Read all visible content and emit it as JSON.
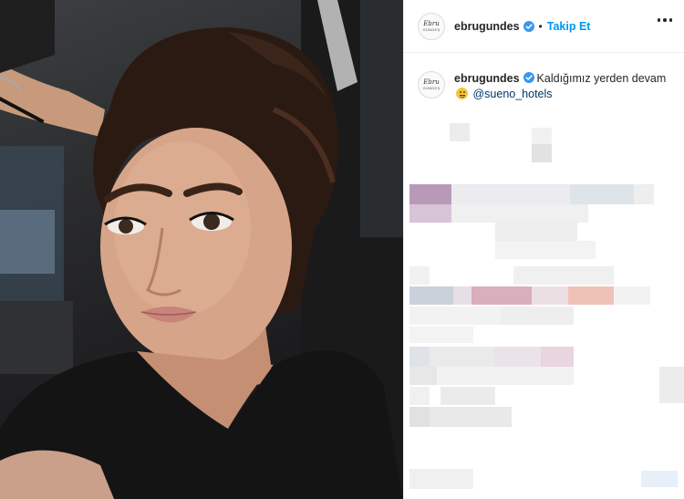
{
  "post": {
    "username": "ebrugundes",
    "follow_label": "Takip Et",
    "separator": "•",
    "avatar_signature": "Ebru",
    "avatar_sub": "GÜNDEŞ"
  },
  "caption": {
    "username": "ebrugundes",
    "text": "Kaldığımız yerden devam",
    "mention": "@sueno_hotels"
  },
  "colors": {
    "verified_badge": "#3897f0",
    "follow": "#0095f6",
    "mention": "#00376b"
  },
  "icons": [
    "verified-badge-icon",
    "more-options-icon",
    "grinning-emoji-icon"
  ]
}
